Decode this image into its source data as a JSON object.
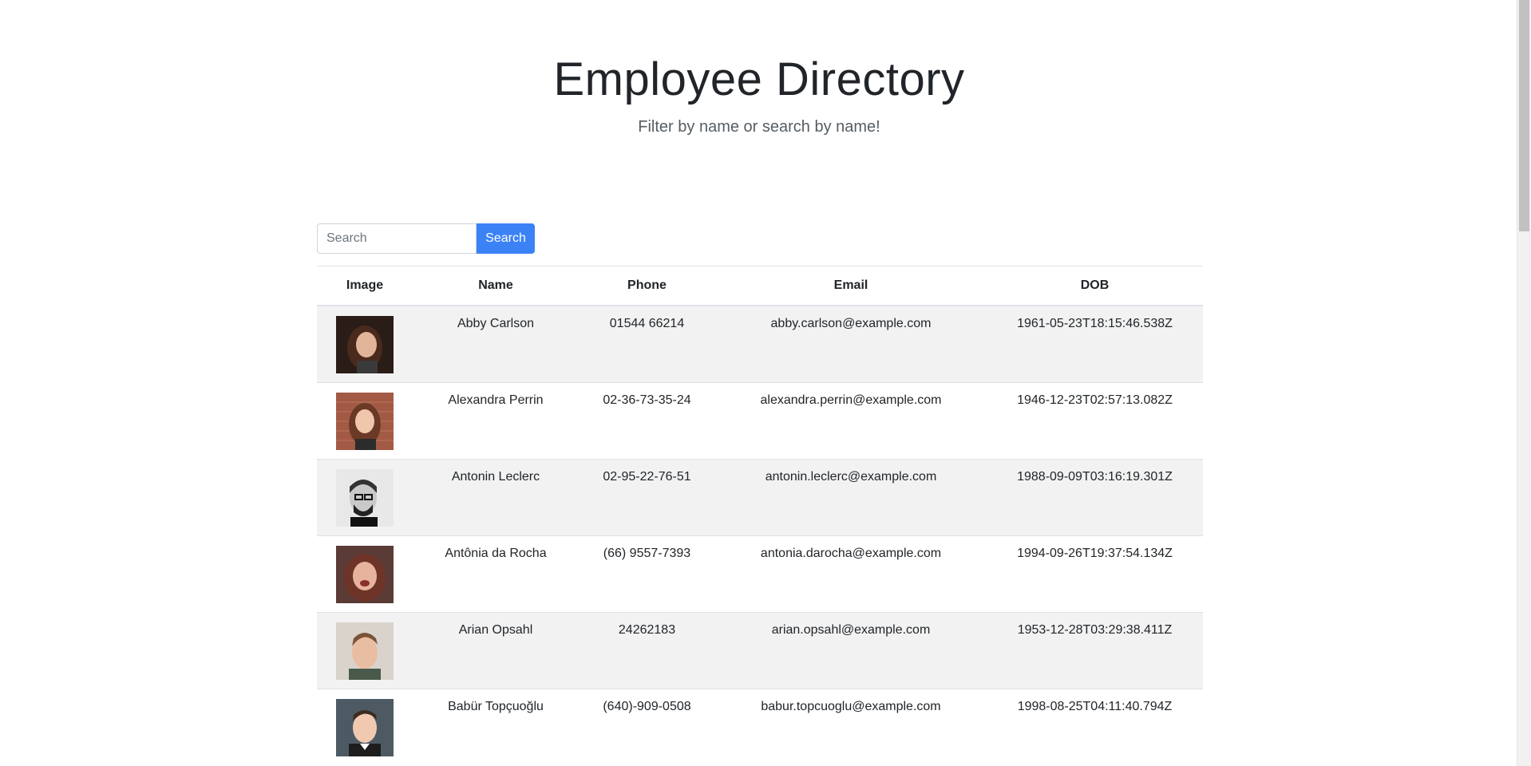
{
  "header": {
    "title": "Employee Directory",
    "subtitle": "Filter by name or search by name!"
  },
  "search": {
    "placeholder": "Search",
    "button_label": "Search"
  },
  "table": {
    "columns": [
      "Image",
      "Name",
      "Phone",
      "Email",
      "DOB"
    ],
    "rows": [
      {
        "name": "Abby Carlson",
        "phone": "01544 66214",
        "email": "abby.carlson@example.com",
        "dob": "1961-05-23T18:15:46.538Z"
      },
      {
        "name": "Alexandra Perrin",
        "phone": "02-36-73-35-24",
        "email": "alexandra.perrin@example.com",
        "dob": "1946-12-23T02:57:13.082Z"
      },
      {
        "name": "Antonin Leclerc",
        "phone": "02-95-22-76-51",
        "email": "antonin.leclerc@example.com",
        "dob": "1988-09-09T03:16:19.301Z"
      },
      {
        "name": "Antônia da Rocha",
        "phone": "(66) 9557-7393",
        "email": "antonia.darocha@example.com",
        "dob": "1994-09-26T19:37:54.134Z"
      },
      {
        "name": "Arian Opsahl",
        "phone": "24262183",
        "email": "arian.opsahl@example.com",
        "dob": "1953-12-28T03:29:38.411Z"
      },
      {
        "name": "Babür Topçuoğlu",
        "phone": "(640)-909-0508",
        "email": "babur.topcuoglu@example.com",
        "dob": "1998-08-25T04:11:40.794Z"
      }
    ]
  },
  "colors": {
    "accent": "#3b82f6",
    "stripe": "#f2f2f2",
    "border": "#dee2e6"
  }
}
